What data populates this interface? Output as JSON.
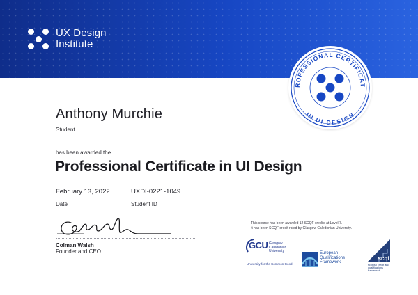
{
  "brand": {
    "name_line1": "UX Design",
    "name_line2": "Institute"
  },
  "badge": {
    "top_text": "PROFESSIONAL CERTIFICATE",
    "bottom_text": "IN UI DESIGN"
  },
  "recipient": {
    "name": "Anthony Murchie",
    "role": "Student"
  },
  "award": {
    "intro": "has been awarded the",
    "title": "Professional Certificate in UI Design"
  },
  "details": {
    "date_value": "February 13, 2022",
    "date_label": "Date",
    "id_value": "UXDI-0221-1049",
    "id_label": "Student ID"
  },
  "signatory": {
    "name": "Colman Walsh",
    "role": "Founder and CEO"
  },
  "credit_note": {
    "line1": "This course has been awarded 12 SCQF credits at Level 7.",
    "line2": "It has been SCQF credit rated by Glasgow Caledonian University."
  },
  "partners": {
    "gcu_abbr": "GCU",
    "gcu_name_line1": "Glasgow Caledonian",
    "gcu_name_line2": "University",
    "gcu_tagline": "University for the Common Good",
    "eqf_line1": "European",
    "eqf_line2": "Qualifications",
    "eqf_line3": "Framework",
    "scqf_name": "scqf",
    "scqf_tag_line1": "scottish credit and",
    "scqf_tag_line2": "qualifications framework"
  },
  "colors": {
    "header_dark": "#0f2d8a",
    "header_light": "#2a63e0",
    "badge_blue": "#1747c4",
    "text": "#1b1b20"
  }
}
